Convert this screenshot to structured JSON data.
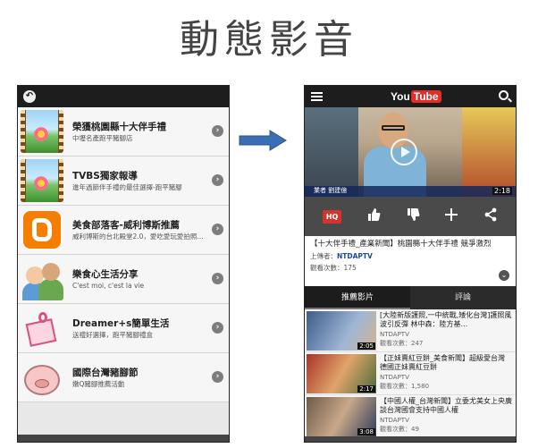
{
  "page": {
    "title": "動態影音"
  },
  "left": {
    "items": [
      {
        "title": "榮獲桃園縣十大伴手禮",
        "subtitle": "中壢名產跑平豬腳店"
      },
      {
        "title": "TVBS獨家報導",
        "subtitle": "進年過節伴手禮的最佳選擇-跑平豬腳"
      },
      {
        "title": "美食部落客-威利博斯推薦",
        "subtitle": "威利博斯的台北殿堂2.0，愛吃愛玩愛拍照..."
      },
      {
        "title": "樂食心生活分享",
        "subtitle": "C'est moi, c'est la vie"
      },
      {
        "title": "Dreamer+s簡單生活",
        "subtitle": "送禮好選擇，跑平豬腳禮盒"
      },
      {
        "title": "國際台灣豬腳節",
        "subtitle": "嫩Q豬腳推薦活動"
      }
    ]
  },
  "right": {
    "logo": {
      "you": "You",
      "tube": "Tube"
    },
    "video": {
      "duration": "2:18",
      "caption": "業者  劉建億"
    },
    "actions": {
      "hq": "HQ"
    },
    "info": {
      "title": "【十大伴手禮_產業新聞】桃園縣十大伴手禮 競爭激烈",
      "uploader_label": "上傳者：",
      "uploader": "NTDAPTV",
      "views": "觀看次數：175"
    },
    "tabs": [
      "推薦影片",
      "評論"
    ],
    "related": [
      {
        "title": "[大陸新版護照,一中統戰,矮化台灣]護照風波引反彈 林中森：陸方基...",
        "channel": "NTDAPTV",
        "views": "觀看次數：247",
        "duration": "2:05"
      },
      {
        "title": "【正妹賣紅豆餅_美食新聞】超級愛台灣 德國正妹賣紅豆餅",
        "channel": "NTDAPTV",
        "views": "觀看次數：1,580",
        "duration": "2:17"
      },
      {
        "title": "【中國人權_台灣新聞】立委尤美女上央廣 談台灣國會支持中國人權",
        "channel": "NTDAPTV",
        "views": "觀看次數：49",
        "duration": "3:08"
      }
    ]
  },
  "colors": {
    "accent": "#e52d27",
    "dark": "#1d1d1d",
    "arrow": "#3a6fb5"
  }
}
